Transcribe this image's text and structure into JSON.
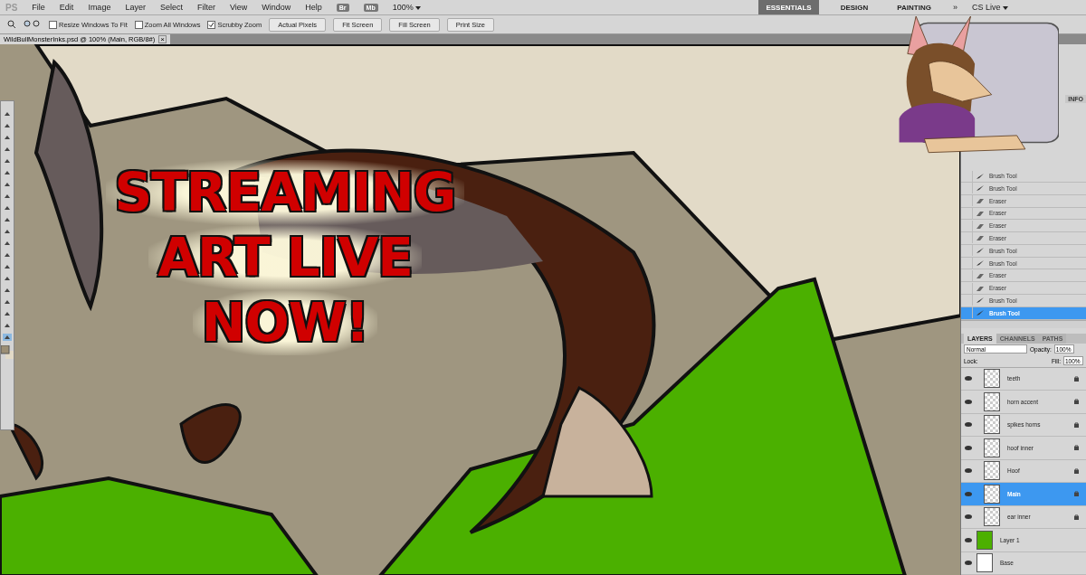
{
  "menu_bar": {
    "logo": "PS",
    "items": [
      "File",
      "Edit",
      "Image",
      "Layer",
      "Select",
      "Filter",
      "View",
      "Window",
      "Help"
    ],
    "bridge": "Br",
    "mini_bridge": "Mb",
    "zoom": "100%"
  },
  "workspaces": [
    {
      "label": "ESSENTIALS",
      "selected": true
    },
    {
      "label": "DESIGN",
      "selected": false
    },
    {
      "label": "PAINTING",
      "selected": false
    }
  ],
  "workspace_more": "»",
  "cs_live": "CS Live",
  "options_bar": {
    "checks": [
      {
        "label": "Resize Windows To Fit",
        "checked": false
      },
      {
        "label": "Zoom All Windows",
        "checked": false
      },
      {
        "label": "Scrubby Zoom",
        "checked": true
      }
    ],
    "buttons": [
      "Actual Pixels",
      "Fit Screen",
      "Fill Screen",
      "Print Size"
    ]
  },
  "document_tab": {
    "title": "WildBullMonsterInks.psd @ 100% (Main, RGB/8#)",
    "close": "×"
  },
  "overlay": {
    "lines": [
      "STREAMING",
      "ART LIVE",
      "NOW!"
    ]
  },
  "info_tab": "INFO",
  "history": [
    {
      "kind": "brush",
      "label": "Brush Tool",
      "selected": false
    },
    {
      "kind": "brush",
      "label": "Brush Tool",
      "selected": false
    },
    {
      "kind": "eraser",
      "label": "Eraser",
      "selected": false
    },
    {
      "kind": "eraser",
      "label": "Eraser",
      "selected": false
    },
    {
      "kind": "eraser",
      "label": "Eraser",
      "selected": false
    },
    {
      "kind": "eraser",
      "label": "Eraser",
      "selected": false
    },
    {
      "kind": "brush",
      "label": "Brush Tool",
      "selected": false
    },
    {
      "kind": "brush",
      "label": "Brush Tool",
      "selected": false
    },
    {
      "kind": "eraser",
      "label": "Eraser",
      "selected": false
    },
    {
      "kind": "eraser",
      "label": "Eraser",
      "selected": false
    },
    {
      "kind": "brush",
      "label": "Brush Tool",
      "selected": false
    },
    {
      "kind": "brush",
      "label": "Brush Tool",
      "selected": true
    }
  ],
  "layers_panel": {
    "tabs": [
      {
        "label": "LAYERS",
        "selected": true
      },
      {
        "label": "CHANNELS",
        "selected": false
      },
      {
        "label": "PATHS",
        "selected": false
      }
    ],
    "blend_mode": "Normal",
    "opacity_label": "Opacity:",
    "opacity": "100%",
    "lock_label": "Lock:",
    "fill_label": "Fill:",
    "fill": "100%",
    "layers": [
      {
        "name": "teeth",
        "locked": true,
        "selected": false
      },
      {
        "name": "horn accent",
        "locked": true,
        "selected": false
      },
      {
        "name": "spikes horns",
        "locked": true,
        "selected": false
      },
      {
        "name": "hoof inner",
        "locked": true,
        "selected": false
      },
      {
        "name": "Hoof",
        "locked": true,
        "selected": false
      },
      {
        "name": "Main",
        "locked": true,
        "selected": true
      },
      {
        "name": "ear inner",
        "locked": true,
        "selected": false
      },
      {
        "name": "Layer 1",
        "color": "#4cb000",
        "locked": false,
        "selected": false
      },
      {
        "name": "Base",
        "color": "#ffffff",
        "locked": false,
        "selected": false
      }
    ]
  }
}
